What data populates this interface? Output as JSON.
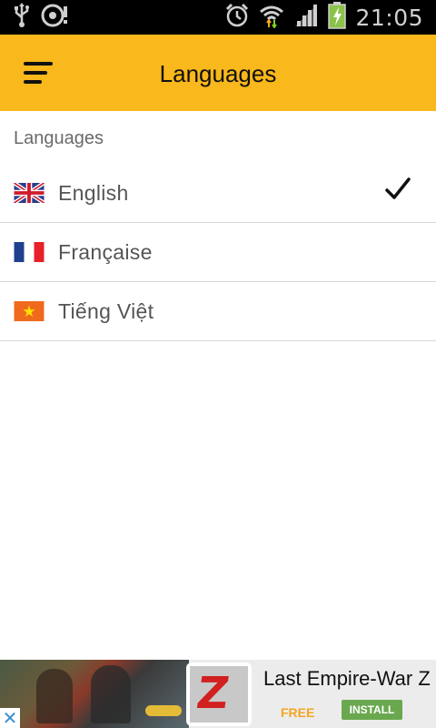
{
  "status_bar": {
    "time": "21:05",
    "icons": [
      "usb-icon",
      "disc-icon",
      "alarm-icon",
      "wifi-icon",
      "signal-icon",
      "battery-charging-icon"
    ]
  },
  "app_bar": {
    "title": "Languages",
    "color": "#f9b81b"
  },
  "section": {
    "header": "Languages"
  },
  "languages": [
    {
      "label": "English",
      "flag": "uk-flag-icon",
      "selected": true
    },
    {
      "label": "Française",
      "flag": "france-flag-icon",
      "selected": false
    },
    {
      "label": "Tiếng Việt",
      "flag": "vietnam-flag-icon",
      "selected": false
    }
  ],
  "ad": {
    "title": "Last Empire-War Z",
    "price": "FREE",
    "install_label": "INSTALL",
    "close_glyph": "✕",
    "icon_letter": "Z"
  }
}
